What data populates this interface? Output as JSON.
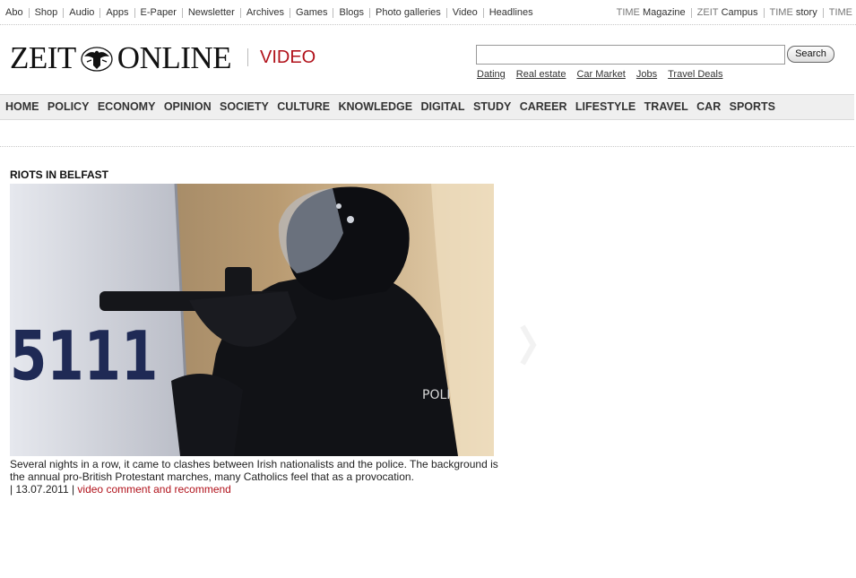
{
  "topbar": {
    "left_links": [
      "Abo",
      "Shop",
      "Audio",
      "Apps",
      "E-Paper",
      "Newsletter",
      "Archives",
      "Games",
      "Blogs",
      "Photo galleries",
      "Video",
      "Headlines"
    ],
    "right_links": [
      {
        "prefix": "TIME",
        "name": "Magazine"
      },
      {
        "prefix": "ZEIT",
        "name": "Campus"
      },
      {
        "prefix": "TIME",
        "name": "story"
      },
      {
        "prefix": "TIME",
        "name": ""
      }
    ]
  },
  "masthead": {
    "logo_left": "ZEIT",
    "logo_right": "ONLINE",
    "section": "VIDEO",
    "search_placeholder": "",
    "search_button": "Search",
    "service_links": [
      "Dating",
      "Real estate",
      "Car Market",
      "Jobs",
      "Travel Deals"
    ]
  },
  "nav": {
    "items": [
      "HOME",
      "POLICY",
      "ECONOMY",
      "OPINION",
      "SOCIETY",
      "CULTURE",
      "KNOWLEDGE",
      "DIGITAL",
      "STUDY",
      "CAREER",
      "LIFESTYLE",
      "TRAVEL",
      "CAR",
      "SPORTS"
    ]
  },
  "article": {
    "headline": "RIOTS IN BELFAST",
    "video_shield_text": "5111",
    "video_vest_text": "POLI",
    "caption": "Several nights in a row, it came to clashes between Irish nationalists and the police. The background is the annual pro-British Protestant marches, many Catholics feel that as a provocation.",
    "meta_prefix": "| 13.07.2011 |",
    "cta": "video comment and recommend"
  },
  "colors": {
    "accent_red": "#b1121b",
    "nav_bg": "#efefef"
  }
}
